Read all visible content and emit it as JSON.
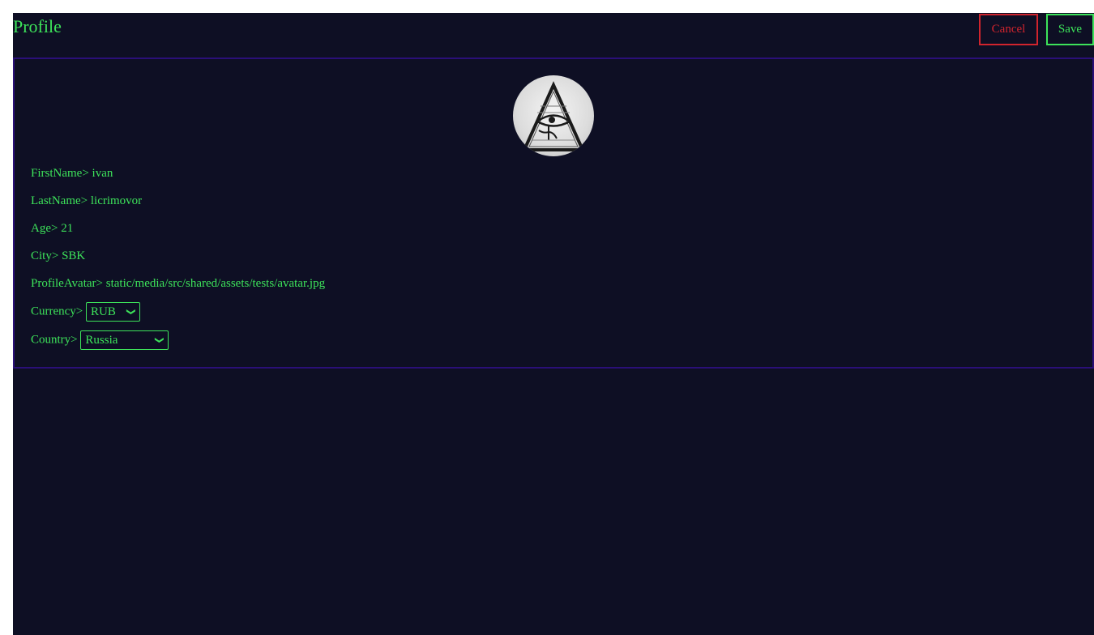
{
  "header": {
    "title": "Profile",
    "cancel_label": "Cancel",
    "save_label": "Save"
  },
  "profile": {
    "avatar_icon": "eye-of-providence-avatar",
    "fields": {
      "first_name": {
        "label": "FirstName>",
        "value": "ivan"
      },
      "last_name": {
        "label": "LastName>",
        "value": "licrimovor"
      },
      "age": {
        "label": "Age>",
        "value": "21"
      },
      "city": {
        "label": "City>",
        "value": "SBK"
      },
      "avatar": {
        "label": "ProfileAvatar>",
        "value": "static/media/src/shared/assets/tests/avatar.jpg"
      },
      "currency": {
        "label": "Currency>",
        "value": "RUB"
      },
      "country": {
        "label": "Country>",
        "value": "Russia"
      }
    }
  },
  "colors": {
    "background": "#0e0f24",
    "text": "#3de35a",
    "cancel": "#d1242d",
    "card_border": "#2a0f78"
  }
}
